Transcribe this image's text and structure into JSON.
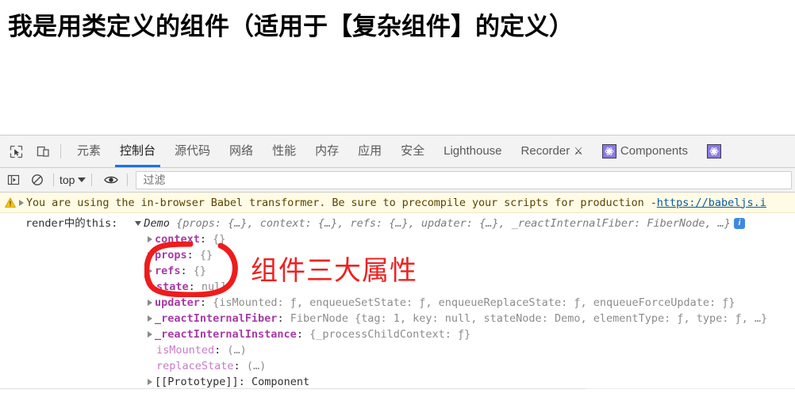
{
  "page": {
    "title": "我是用类定义的组件（适用于【复杂组件】的定义）"
  },
  "devtools": {
    "toolbar_icons": [
      {
        "name": "inspect-element-icon",
        "label": "Inspect element"
      },
      {
        "name": "device-toolbar-icon",
        "label": "Toggle device toolbar"
      }
    ],
    "tabs": [
      {
        "id": "elements",
        "label": "元素",
        "active": false,
        "icon": null
      },
      {
        "id": "console",
        "label": "控制台",
        "active": true,
        "icon": null
      },
      {
        "id": "sources",
        "label": "源代码",
        "active": false,
        "icon": null
      },
      {
        "id": "network",
        "label": "网络",
        "active": false,
        "icon": null
      },
      {
        "id": "performance",
        "label": "性能",
        "active": false,
        "icon": null
      },
      {
        "id": "memory",
        "label": "内存",
        "active": false,
        "icon": null
      },
      {
        "id": "application",
        "label": "应用",
        "active": false,
        "icon": null
      },
      {
        "id": "security",
        "label": "安全",
        "active": false,
        "icon": null
      },
      {
        "id": "lighthouse",
        "label": "Lighthouse",
        "active": false,
        "icon": null
      },
      {
        "id": "recorder",
        "label": "Recorder",
        "active": false,
        "icon": "flask-icon"
      },
      {
        "id": "components",
        "label": "Components",
        "active": false,
        "icon": "react-icon"
      },
      {
        "id": "profiler",
        "label": "",
        "active": false,
        "icon": "react-icon"
      }
    ],
    "console_toolbar": {
      "sidebar_toggle_icon": "console-sidebar-icon",
      "clear_icon": "clear-console-icon",
      "context_selector": "top",
      "eye_icon": "live-expression-eye-icon",
      "filter_placeholder": "过滤",
      "filter_value": ""
    },
    "console": {
      "warning": {
        "level": "warning",
        "icon": "warning-triangle-icon",
        "text": "You are using the in-browser Babel transformer. Be sure to precompile your scripts for production - ",
        "link": "https://babeljs.i"
      },
      "entries": [
        {
          "id": "line-0",
          "indent": 0,
          "prefix": "render中的this:",
          "disclosure": "open",
          "object_name": "Demo",
          "preview": "{props: {…}, context: {…}, refs: {…}, updater: {…}, _reactInternalFiber: FiberNode, …}",
          "badge": "i"
        },
        {
          "id": "line-1",
          "indent": 1,
          "disclosure": "closed",
          "key": "context",
          "value": "{}",
          "value_style": "gray"
        },
        {
          "id": "line-2",
          "indent": 1,
          "disclosure": "closed",
          "key": "props",
          "value": "{}",
          "value_style": "gray"
        },
        {
          "id": "line-3",
          "indent": 1,
          "disclosure": "closed",
          "key": "refs",
          "value": "{}",
          "value_style": "gray"
        },
        {
          "id": "line-4",
          "indent": 1,
          "disclosure": "none",
          "key": "state",
          "value": "null",
          "value_style": "gray"
        },
        {
          "id": "line-5",
          "indent": 1,
          "disclosure": "closed",
          "key": "updater",
          "value": "{isMounted: ƒ, enqueueSetState: ƒ, enqueueReplaceState: ƒ, enqueueForceUpdate: ƒ}",
          "value_style": "gray"
        },
        {
          "id": "line-6",
          "indent": 1,
          "disclosure": "closed",
          "key": "_reactInternalFiber",
          "value": "FiberNode {tag: 1, key: null, stateNode: Demo, elementType: ƒ, type: ƒ, …}",
          "value_style": "gray"
        },
        {
          "id": "line-7",
          "indent": 1,
          "disclosure": "closed",
          "key": "_reactInternalInstance",
          "value": "{_processChildContext: ƒ}",
          "value_style": "gray"
        },
        {
          "id": "line-8",
          "indent": 2,
          "disclosure": "none",
          "key": "isMounted",
          "key_style": "plain",
          "value": "(…)",
          "value_style": "gray"
        },
        {
          "id": "line-9",
          "indent": 2,
          "disclosure": "none",
          "key": "replaceState",
          "key_style": "plain",
          "value": "(…)",
          "value_style": "gray"
        },
        {
          "id": "line-10",
          "indent": 1,
          "disclosure": "closed",
          "key": "[[Prototype]]",
          "key_style": "dark",
          "value": "Component",
          "value_style": "dark"
        }
      ]
    }
  },
  "annotation": {
    "circle_color": "#ee2222",
    "text": "组件三大属性",
    "text_color": "#ee2222"
  }
}
